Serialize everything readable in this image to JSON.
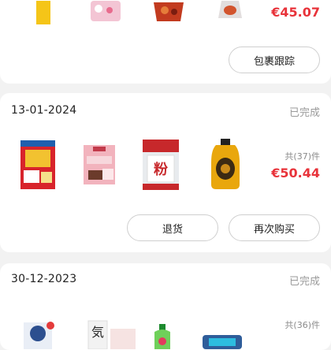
{
  "orders": [
    {
      "price": "€45.07",
      "actions": {
        "track": "包裹跟踪"
      }
    },
    {
      "date": "13-01-2024",
      "status": "已完成",
      "count": "共(37)件",
      "price": "€50.44",
      "actions": {
        "return": "退货",
        "rebuy": "再次购买"
      },
      "product_labels": {
        "noodle": "粉"
      }
    },
    {
      "date": "30-12-2023",
      "status": "已完成",
      "count": "共(36)件",
      "product_labels": {
        "can": "気"
      }
    }
  ],
  "colors": {
    "accent_price": "#e8333a",
    "status_gray": "#9a9a9a"
  }
}
